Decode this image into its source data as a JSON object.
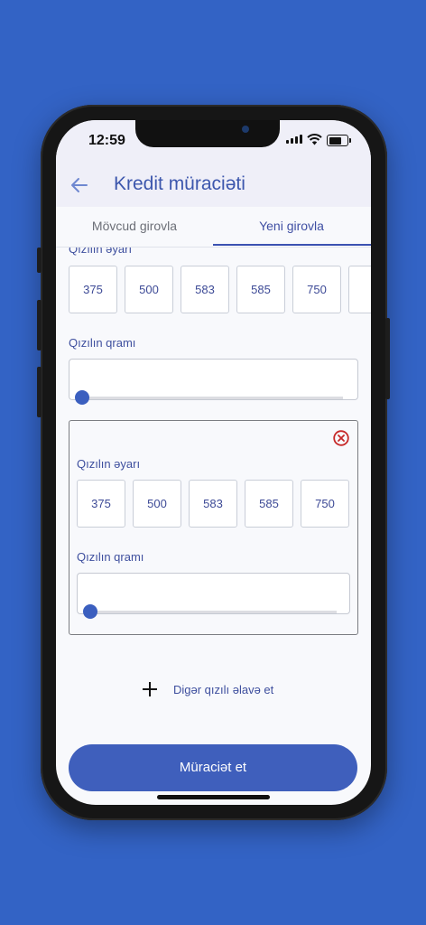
{
  "status": {
    "time": "12:59"
  },
  "appbar": {
    "title": "Kredit müraciəti",
    "back_icon": "arrow-left-icon"
  },
  "tabs": [
    {
      "label": "Mövcud girovla",
      "active": false
    },
    {
      "label": "Yeni girovla",
      "active": true
    }
  ],
  "gold_1": {
    "purity_label": "Qızılın əyarı",
    "purity_options": [
      "375",
      "500",
      "583",
      "585",
      "750"
    ],
    "weight_label": "Qızılın qramı",
    "weight_value": "",
    "slider_fraction": 0
  },
  "gold_2": {
    "purity_label": "Qızılın əyarı",
    "purity_options": [
      "375",
      "500",
      "583",
      "585",
      "750"
    ],
    "weight_label": "Qızılın qramı",
    "weight_value": "",
    "slider_fraction": 0,
    "remove_icon": "close-circle-icon"
  },
  "add_more": {
    "label": "Digər qızılı əlavə et",
    "icon": "plus-icon"
  },
  "submit": {
    "label": "Müraciət et"
  },
  "colors": {
    "primary": "#3f5fbc",
    "background": "#3363c5",
    "error": "#c62828"
  }
}
